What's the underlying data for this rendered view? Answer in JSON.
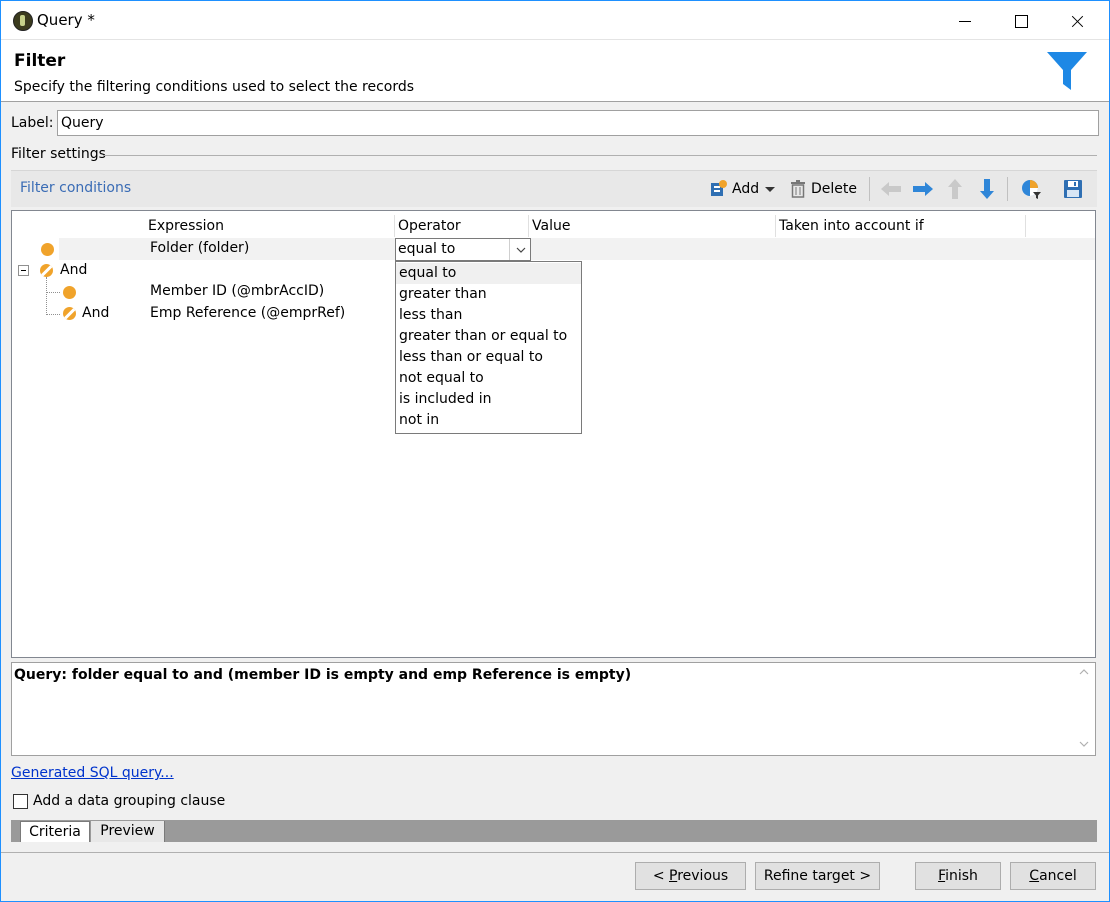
{
  "window": {
    "title": "Query *"
  },
  "header": {
    "title": "Filter",
    "subtitle": "Specify the filtering conditions used to select the records"
  },
  "label_field": {
    "label": "Label:",
    "value": "Query"
  },
  "filter_settings": {
    "legend": "Filter settings"
  },
  "toolbar": {
    "title": "Filter conditions",
    "add_label": "Add",
    "delete_label": "Delete"
  },
  "grid": {
    "columns": [
      "Expression",
      "Operator",
      "Value",
      "Taken into account if"
    ],
    "rows": [
      {
        "expression": "Folder (folder)",
        "operator": "equal to"
      },
      {
        "node": "And"
      },
      {
        "expression": "Member ID (@mbrAccID)"
      },
      {
        "node": "And",
        "expression": "Emp Reference (@emprRef)"
      }
    ]
  },
  "operator_dropdown": {
    "selected": "equal to",
    "options": [
      "equal to",
      "greater than",
      "less than",
      "greater than or equal to",
      "less than or equal to",
      "not equal to",
      "is included in",
      "not in"
    ]
  },
  "query_summary": "Query: folder equal to  and (member ID is empty and emp Reference is empty)",
  "sql_link": "Generated SQL query...",
  "grouping_checkbox": {
    "label": "Add a data grouping clause",
    "checked": false
  },
  "tabs": [
    "Criteria",
    "Preview"
  ],
  "buttons": {
    "previous": {
      "label": "< Previous",
      "underline_char": "P"
    },
    "refine": "Refine target >",
    "finish": {
      "label": "Finish",
      "underline_char": "F"
    },
    "cancel": {
      "label": "Cancel",
      "underline_char": "C"
    }
  },
  "colors": {
    "accent_link": "#0033cc",
    "title_blue": "#3a6cb5",
    "node_orange": "#f0a32b",
    "funnel_blue": "#1e88e5"
  }
}
